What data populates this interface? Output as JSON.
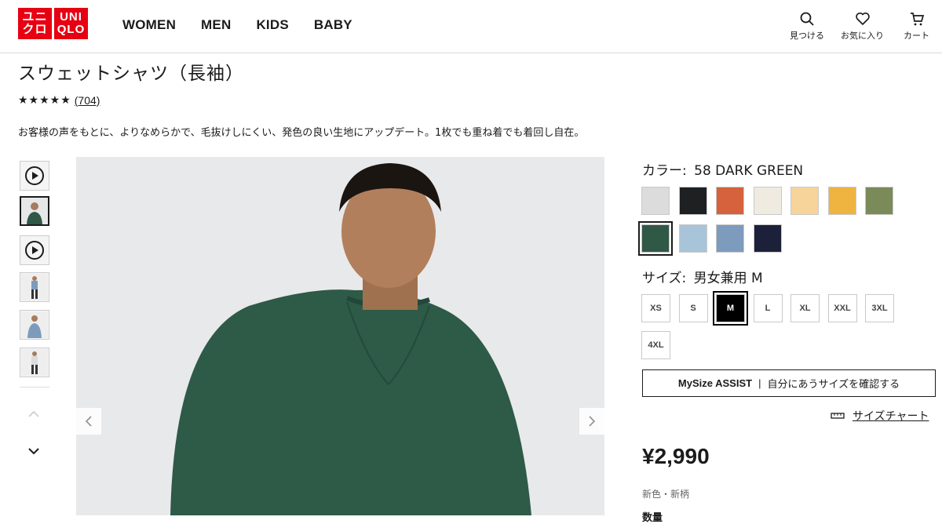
{
  "header": {
    "logo": {
      "line1": "ユニ",
      "line2": "クロ",
      "line3": "UNI",
      "line4": "QLO"
    },
    "nav": [
      "WOMEN",
      "MEN",
      "KIDS",
      "BABY"
    ],
    "utils": {
      "search": "見つける",
      "favorites": "お気に入り",
      "cart": "カート"
    }
  },
  "product": {
    "title": "スウェットシャツ（長袖）",
    "stars": "★★★★★",
    "rating": 4.5,
    "review_count": "(704)",
    "description": "お客様の声をもとに、よりなめらかで、毛抜けしにくい、発色の良い生地にアップデート。1枚でも重ね着でも着回し自在。"
  },
  "gallery": {
    "thumbnails": [
      "play-video",
      "photo-front",
      "play-video",
      "photo-full-body",
      "photo-side",
      "photo-full-body-2"
    ]
  },
  "color": {
    "label": "カラー:",
    "selected": "58 DARK GREEN",
    "swatches": [
      "#dcdcdc",
      "#1e2022",
      "#d5623c",
      "#efebe0",
      "#f6d49a",
      "#efb43f",
      "#7a8a59",
      "#2f5847",
      "#a8c4d8",
      "#7d9bbd",
      "#1c2038"
    ],
    "selected_index": 7
  },
  "size": {
    "label": "サイズ:",
    "selected": "男女兼用 M",
    "options": [
      "XS",
      "S",
      "M",
      "L",
      "XL",
      "XXL",
      "3XL",
      "4XL"
    ],
    "selected_index": 2
  },
  "mysize": {
    "brand": "MySize ASSIST",
    "sep": "|",
    "text": "自分にあうサイズを確認する"
  },
  "size_chart": "サイズチャート",
  "price": "¥2,990",
  "tag": "新色・新柄",
  "quantity_label": "数量"
}
